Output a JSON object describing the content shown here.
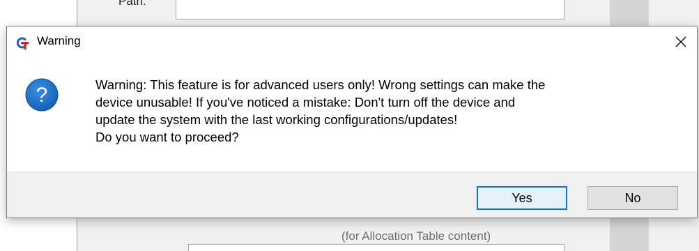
{
  "background": {
    "path_label": "Path:",
    "hint_text": "(for Allocation Table content)"
  },
  "dialog": {
    "title": "Warning",
    "app_icon": "gt-app-icon",
    "close_icon": "close-icon",
    "message_icon": "question-icon",
    "message_lines": [
      "Warning: This feature is for advanced users only! Wrong settings can make the",
      "device unusable! If you've noticed a mistake: Don't turn off the device and",
      "update the system with the last working configurations/updates!",
      "Do you want to proceed?"
    ],
    "buttons": {
      "yes": "Yes",
      "no": "No"
    }
  },
  "colors": {
    "accent": "#0078d7",
    "question_blue": "#1a6fc4",
    "footer_bg": "#f0f0f0"
  }
}
